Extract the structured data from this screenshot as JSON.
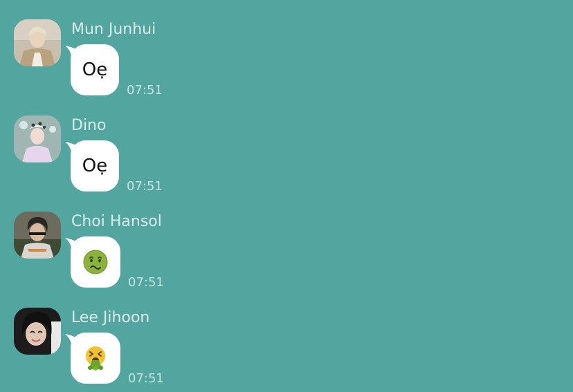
{
  "colors": {
    "background": "#52a69f",
    "bubble": "#ffffff",
    "sender_name": "#d9ecea",
    "timestamp": "#c4e3df"
  },
  "messages": [
    {
      "sender": "Mun Junhui",
      "text": "Oẹ",
      "emoji": "",
      "time": "07:51"
    },
    {
      "sender": "Dino",
      "text": "Oẹ",
      "emoji": "",
      "time": "07:51"
    },
    {
      "sender": "Choi Hansol",
      "text": "",
      "emoji": "nauseated-face-icon",
      "time": "07:51"
    },
    {
      "sender": "Lee Jihoon",
      "text": "",
      "emoji": "face-vomiting-icon",
      "time": "07:51"
    }
  ]
}
